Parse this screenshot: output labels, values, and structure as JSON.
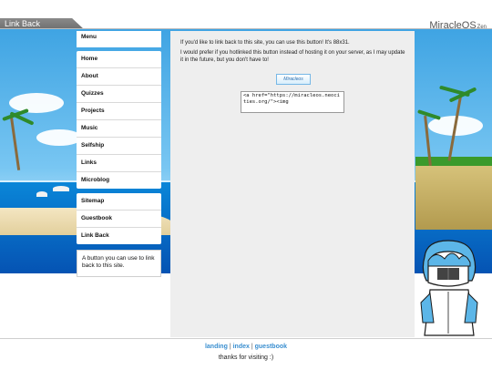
{
  "window": {
    "title": "Link Back",
    "brand": "MiracleOS",
    "brand_suffix": "Zen"
  },
  "sidebar": {
    "header": "Menu",
    "group1": [
      {
        "label": "Home"
      },
      {
        "label": "About"
      },
      {
        "label": "Quizzes"
      },
      {
        "label": "Projects"
      },
      {
        "label": "Music"
      },
      {
        "label": "Selfship"
      },
      {
        "label": "Links"
      },
      {
        "label": "Microblog"
      }
    ],
    "group2": [
      {
        "label": "Sitemap"
      },
      {
        "label": "Guestbook"
      },
      {
        "label": "Link Back"
      }
    ],
    "description": "A button you can use to link back to this site."
  },
  "main": {
    "intro": "If you'd like to link back to this site, you can use this button! It's 88x31.",
    "note": "I would prefer if you hotlinked this button instead of hosting it on your server, as I may update it in the future, but you don't have to!",
    "badge_text": "Miracleos",
    "code": "<a href=\"https://miracleos.neocities.org/\"><img"
  },
  "footer": {
    "links": [
      {
        "label": "landing"
      },
      {
        "label": "index"
      },
      {
        "label": "guestbook"
      }
    ],
    "separator": "|",
    "note": "thanks for visiting :)"
  },
  "colors": {
    "panel": "#eeeeee",
    "link": "#3a8fd0",
    "sea": "#0a86d8",
    "sky": "#5ab6ee"
  }
}
